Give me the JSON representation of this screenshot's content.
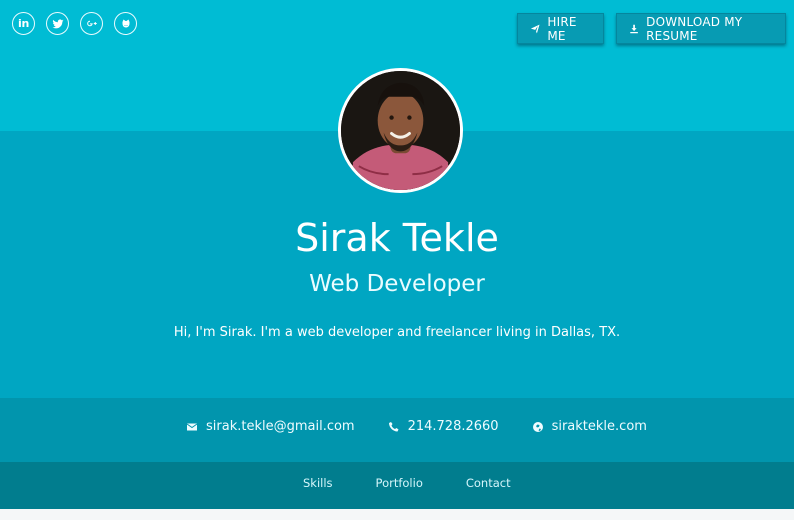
{
  "colors": {
    "top_band": "#00bcd4",
    "main_band": "#00a6c2",
    "contact_band": "#0195ad",
    "nav_band": "#017d8e",
    "text": "#ffffff"
  },
  "social": {
    "linkedin_label": "in",
    "items": [
      {
        "icon": "linkedin-icon"
      },
      {
        "icon": "twitter-icon"
      },
      {
        "icon": "google-plus-icon"
      },
      {
        "icon": "github-icon"
      }
    ]
  },
  "actions": {
    "hire_label": "HIRE ME",
    "download_label": "DOWNLOAD MY RESUME"
  },
  "profile": {
    "name": "Sirak Tekle",
    "title": "Web Developer",
    "intro": "Hi, I'm Sirak. I'm a web developer and freelancer living in Dallas, TX."
  },
  "contact": {
    "email": "sirak.tekle@gmail.com",
    "phone": "214.728.2660",
    "website": "siraktekle.com"
  },
  "nav": {
    "skills": "Skills",
    "portfolio": "Portfolio",
    "contact": "Contact"
  }
}
